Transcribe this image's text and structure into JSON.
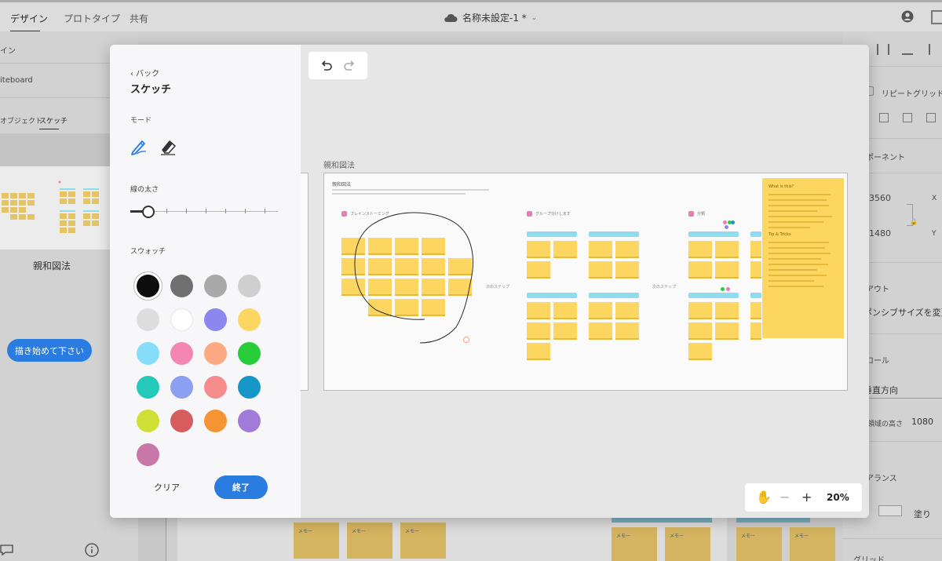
{
  "topbar": {
    "tabs": [
      {
        "label": "デザイン"
      },
      {
        "label": "プロトタイプ"
      },
      {
        "label": "共有"
      }
    ],
    "doc_title": "名称未設定-1 *"
  },
  "left_panel": {
    "row1": "イン",
    "row2": "iteboard",
    "tab_objects": "オブジェクト",
    "tab_sketch": "スケッチ",
    "thumb_label": "親和図法",
    "start_button": "描き始めて下さい"
  },
  "right_panel": {
    "repeat_grid": "リピートグリッド",
    "component": "ポーネント",
    "x_value": "3560",
    "x_label": "X",
    "y_value": "1480",
    "y_label": "Y",
    "layout": "アウト",
    "responsive": "ポンシブサイズを変更",
    "scroll": "ロール",
    "vertical": "垂直方向",
    "viewport_label": "領域の高さ",
    "viewport_value": "1080",
    "appearance": "アランス",
    "fill": "塗り",
    "grid": "グリッド"
  },
  "sketch": {
    "back": "‹ バック",
    "title": "スケッチ",
    "mode_label": "モード",
    "stroke_label": "線の太さ",
    "stroke_value": 0.12,
    "swatch_label": "スウォッチ",
    "swatches": [
      "#0c0c0c",
      "#707070",
      "#a9a9a9",
      "#cfcfcf",
      "#dddddd",
      "#ffffff",
      "#8b87ef",
      "#fdd662",
      "#85ddfa",
      "#f486b3",
      "#fda983",
      "#28cc38",
      "#24c9b9",
      "#8c9ff0",
      "#f58b8b",
      "#1796c8",
      "#cfdf35",
      "#d75c5d",
      "#f59433",
      "#a27ad9",
      "#c877a8"
    ],
    "selected_swatch": 0,
    "clear": "クリア",
    "done": "終了"
  },
  "canvas": {
    "artboard_label": "親和図法",
    "artboard_title": "親和図法",
    "group1": "ブレインストーミング",
    "group2": "グループ分けします",
    "group3": "分類",
    "next_step": "次のステップ",
    "side_note_title": "What is this?",
    "side_note_heading": "Tip & Tricks",
    "note_text": "メモー",
    "zoom_level": "20%"
  },
  "colors": {
    "accent": "#2a7ce0",
    "note": "#fdd662",
    "bar": "#8fdbef"
  }
}
